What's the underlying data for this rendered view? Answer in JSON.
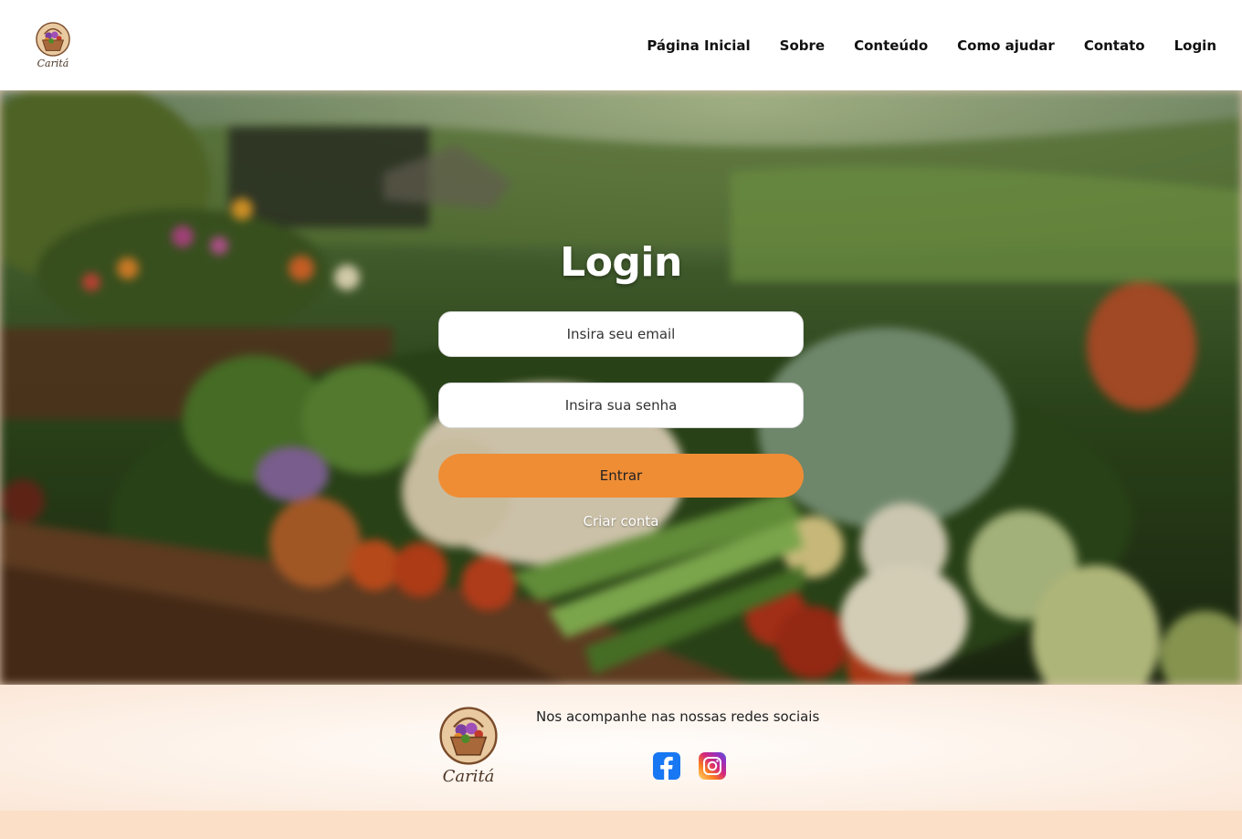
{
  "brand": {
    "name": "Caritá"
  },
  "nav": {
    "items": [
      {
        "label": "Página Inicial"
      },
      {
        "label": "Sobre"
      },
      {
        "label": "Conteúdo"
      },
      {
        "label": "Como ajudar"
      },
      {
        "label": "Contato"
      },
      {
        "label": "Login"
      }
    ]
  },
  "login": {
    "title": "Login",
    "email_placeholder": "Insira seu email",
    "password_placeholder": "Insira sua senha",
    "submit_label": "Entrar",
    "create_account_label": "Criar conta"
  },
  "footer": {
    "social_text": "Nos acompanhe nas nossas redes sociais",
    "social": [
      {
        "icon": "facebook-icon"
      },
      {
        "icon": "instagram-icon"
      }
    ]
  },
  "colors": {
    "accent": "#ef8d35",
    "footer_bg": "#fdf1e7",
    "bottom_band": "#fbdfc6",
    "facebook": "#1877f2"
  }
}
